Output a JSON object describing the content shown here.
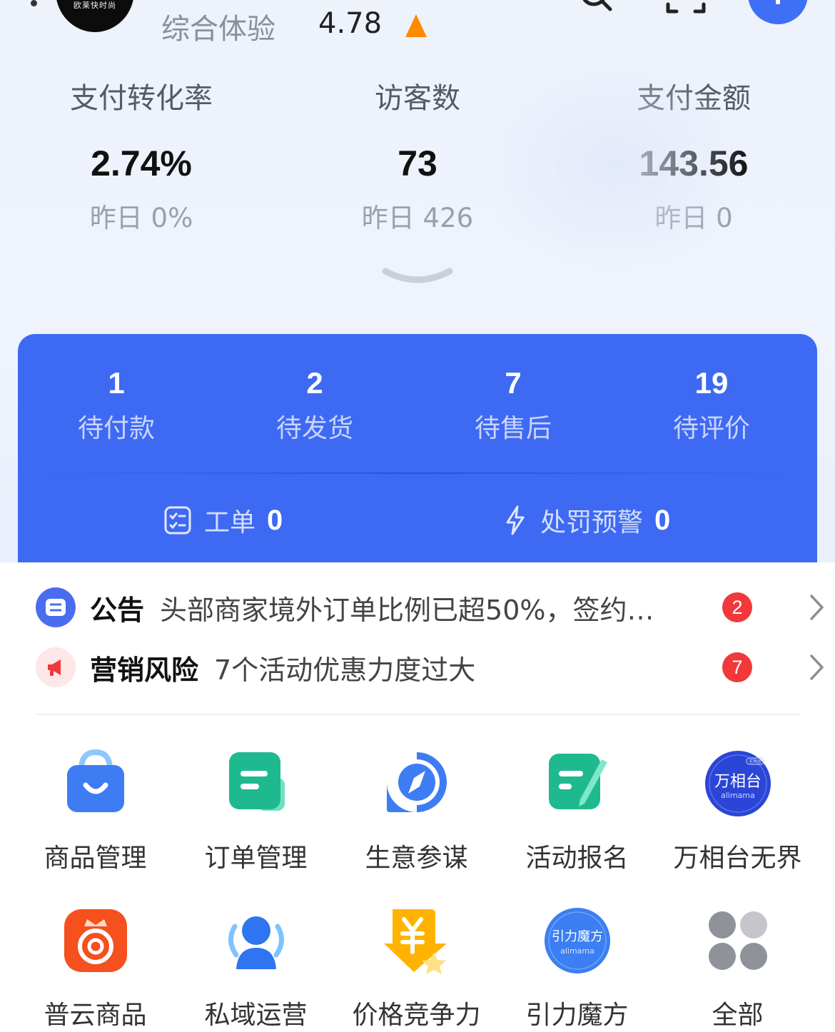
{
  "header": {
    "shop_logo_text": "欧莱快时尚",
    "experience_label": "综合体验",
    "experience_score": "4.78"
  },
  "stats": [
    {
      "label": "支付转化率",
      "value": "2.74%",
      "yesterday": "昨日 0%"
    },
    {
      "label": "访客数",
      "value": "73",
      "yesterday": "昨日 426"
    },
    {
      "label": "支付金额",
      "value": "143.56",
      "yesterday": "昨日 0"
    }
  ],
  "orders": [
    {
      "count": "1",
      "label": "待付款"
    },
    {
      "count": "2",
      "label": "待发货"
    },
    {
      "count": "7",
      "label": "待售后"
    },
    {
      "count": "19",
      "label": "待评价"
    }
  ],
  "tools": {
    "ticket_label": "工单",
    "ticket_value": "0",
    "penalty_label": "处罚预警",
    "penalty_value": "0"
  },
  "notices": [
    {
      "title": "公告",
      "text": "头部商家境外订单比例已超50%，签约…",
      "badge": "2"
    },
    {
      "title": "营销风险",
      "text": "7个活动优惠力度过大",
      "badge": "7"
    }
  ],
  "grid": [
    {
      "label": "商品管理",
      "icon": "shopping-bag-icon"
    },
    {
      "label": "订单管理",
      "icon": "order-list-icon"
    },
    {
      "label": "生意参谋",
      "icon": "compass-icon"
    },
    {
      "label": "活动报名",
      "icon": "edit-form-icon"
    },
    {
      "label": "万相台无界",
      "icon": "wanxiangtai-icon",
      "logo_text": "万相台",
      "logo_sub": "alimama",
      "logo_tag": "无界版"
    },
    {
      "label": "普云商品",
      "icon": "puyun-icon"
    },
    {
      "label": "私域运营",
      "icon": "users-icon"
    },
    {
      "label": "价格竞争力",
      "icon": "price-star-icon"
    },
    {
      "label": "引力魔方",
      "icon": "yinli-icon",
      "logo_text": "引力魔方",
      "logo_sub": "alimama"
    },
    {
      "label": "全部",
      "icon": "all-apps-icon"
    }
  ],
  "colors": {
    "primary_blue": "#3e69f3",
    "badge_red": "#f2383b",
    "arrow_orange": "#ff8a00"
  }
}
